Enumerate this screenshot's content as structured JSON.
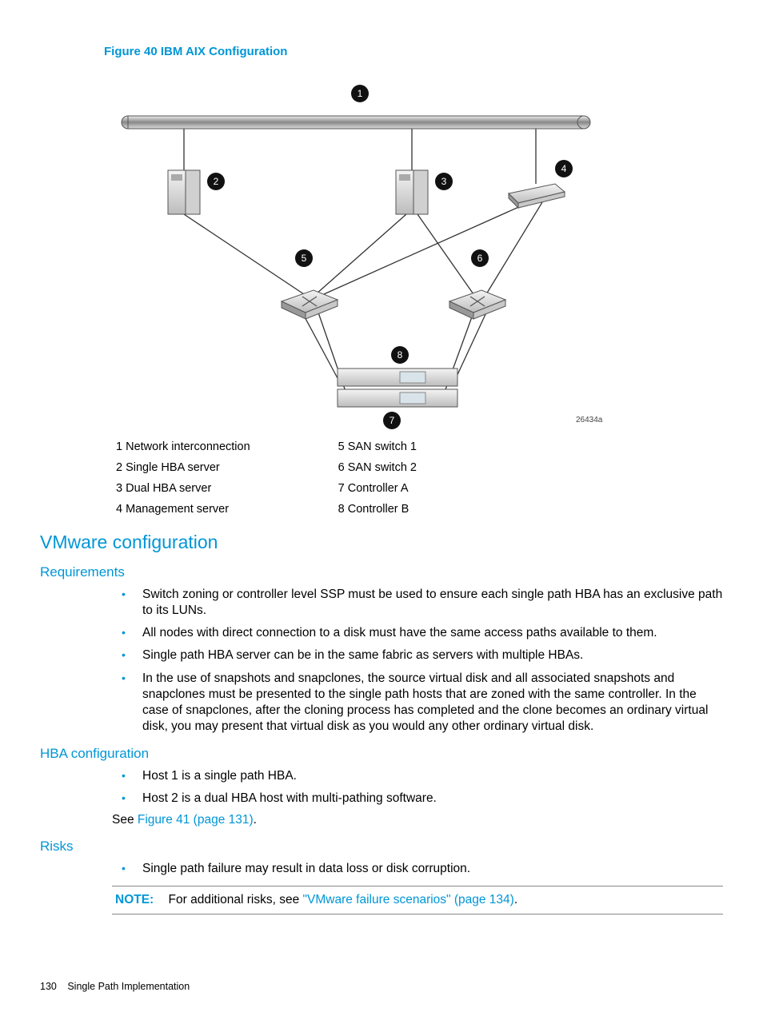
{
  "figure": {
    "caption": "Figure 40 IBM AIX Configuration",
    "ref": "26434a",
    "callouts": [
      "1",
      "2",
      "3",
      "4",
      "5",
      "6",
      "7",
      "8"
    ],
    "legend_left": [
      "1 Network interconnection",
      "2 Single HBA server",
      "3 Dual HBA server",
      "4 Management server"
    ],
    "legend_right": [
      "5 SAN switch 1",
      "6 SAN switch 2",
      "7 Controller A",
      "8 Controller B"
    ],
    "icons": {
      "top": "network-interconnection-bar",
      "server_single": "server-tower-icon",
      "server_dual": "server-tower-icon",
      "mgmt": "server-rack-icon",
      "switch5": "san-switch-icon",
      "switch6": "san-switch-icon",
      "controller": "controller-unit-icon"
    }
  },
  "sections": {
    "vmware_title": "VMware configuration",
    "requirements_title": "Requirements",
    "requirements": [
      "Switch zoning or controller level SSP must be used to ensure each single path HBA has an exclusive path to its LUNs.",
      "All nodes with direct connection to a disk must have the same access paths available to them.",
      "Single path HBA server can be in the same fabric as servers with multiple HBAs.",
      "In the use of snapshots and snapclones, the source virtual disk and all associated snapshots and snapclones must be presented to the single path hosts that are zoned with the same controller. In the case of snapclones, after the cloning process has completed and the clone becomes an ordinary virtual disk, you may present that virtual disk as you would any other ordinary virtual disk."
    ],
    "hba_title": "HBA configuration",
    "hba": [
      "Host 1 is a single path HBA.",
      "Host 2 is a dual HBA host with multi-pathing software."
    ],
    "see_prefix": "See ",
    "see_link": "Figure 41 (page 131)",
    "see_suffix": ".",
    "risks_title": "Risks",
    "risks": [
      "Single path failure may result in data loss or disk corruption."
    ],
    "note_label": "NOTE:",
    "note_prefix": "For additional risks, see ",
    "note_link": "\"VMware failure scenarios\" (page 134)",
    "note_suffix": "."
  },
  "footer": {
    "page_number": "130",
    "section": "Single Path Implementation"
  }
}
